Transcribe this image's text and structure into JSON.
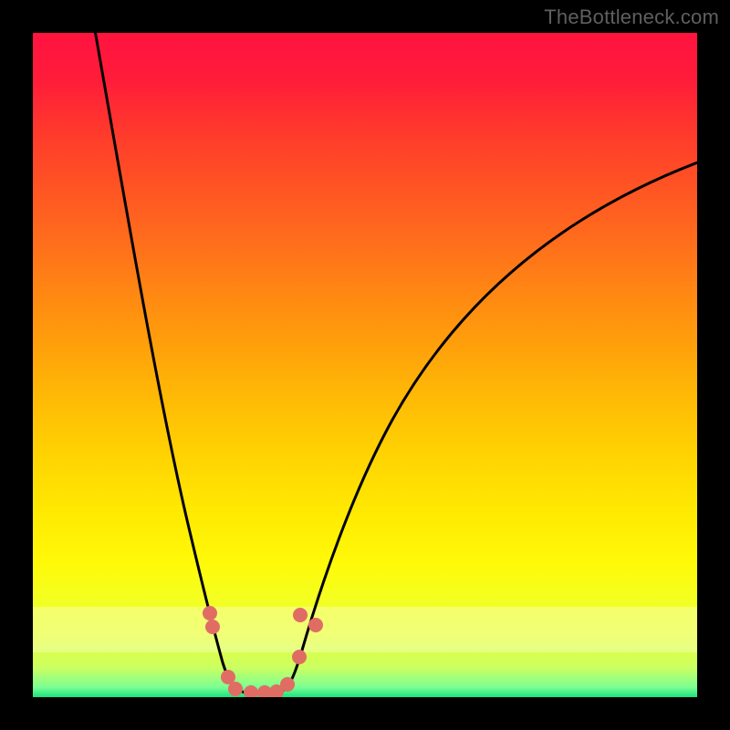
{
  "watermark": "TheBottleneck.com",
  "chart_data": {
    "type": "line",
    "title": "",
    "xlabel": "",
    "ylabel": "",
    "xlim": [
      0,
      100
    ],
    "ylim": [
      0,
      100
    ],
    "series": [
      {
        "name": "bottleneck-curve",
        "x": [
          9,
          14,
          19,
          23,
          27,
          29.5,
          33,
          36,
          38,
          40.5,
          44,
          50,
          60,
          72,
          85,
          100
        ],
        "values": [
          103,
          80,
          55,
          35,
          18,
          8,
          0.5,
          0.5,
          3,
          7,
          15,
          28,
          45,
          60,
          71,
          81
        ]
      }
    ],
    "markers": {
      "name": "sample-points",
      "x": [
        27,
        27.4,
        29.7,
        30.8,
        33,
        35,
        37,
        38.6,
        40.3,
        40.5,
        42.8
      ],
      "values": [
        13,
        11,
        3,
        1.3,
        0.7,
        0.7,
        0.8,
        1.9,
        6,
        12,
        10.6
      ],
      "color": "#e06d64"
    },
    "threshold_band": {
      "y_low": 7,
      "y_high": 14,
      "opacity": 0.32
    },
    "background_gradient": {
      "direction": "vertical",
      "stops": [
        {
          "pos": 0.0,
          "color": "#ff133f"
        },
        {
          "pos": 0.5,
          "color": "#ffb006"
        },
        {
          "pos": 0.8,
          "color": "#fffa09"
        },
        {
          "pos": 1.0,
          "color": "#18e27e"
        }
      ]
    }
  }
}
